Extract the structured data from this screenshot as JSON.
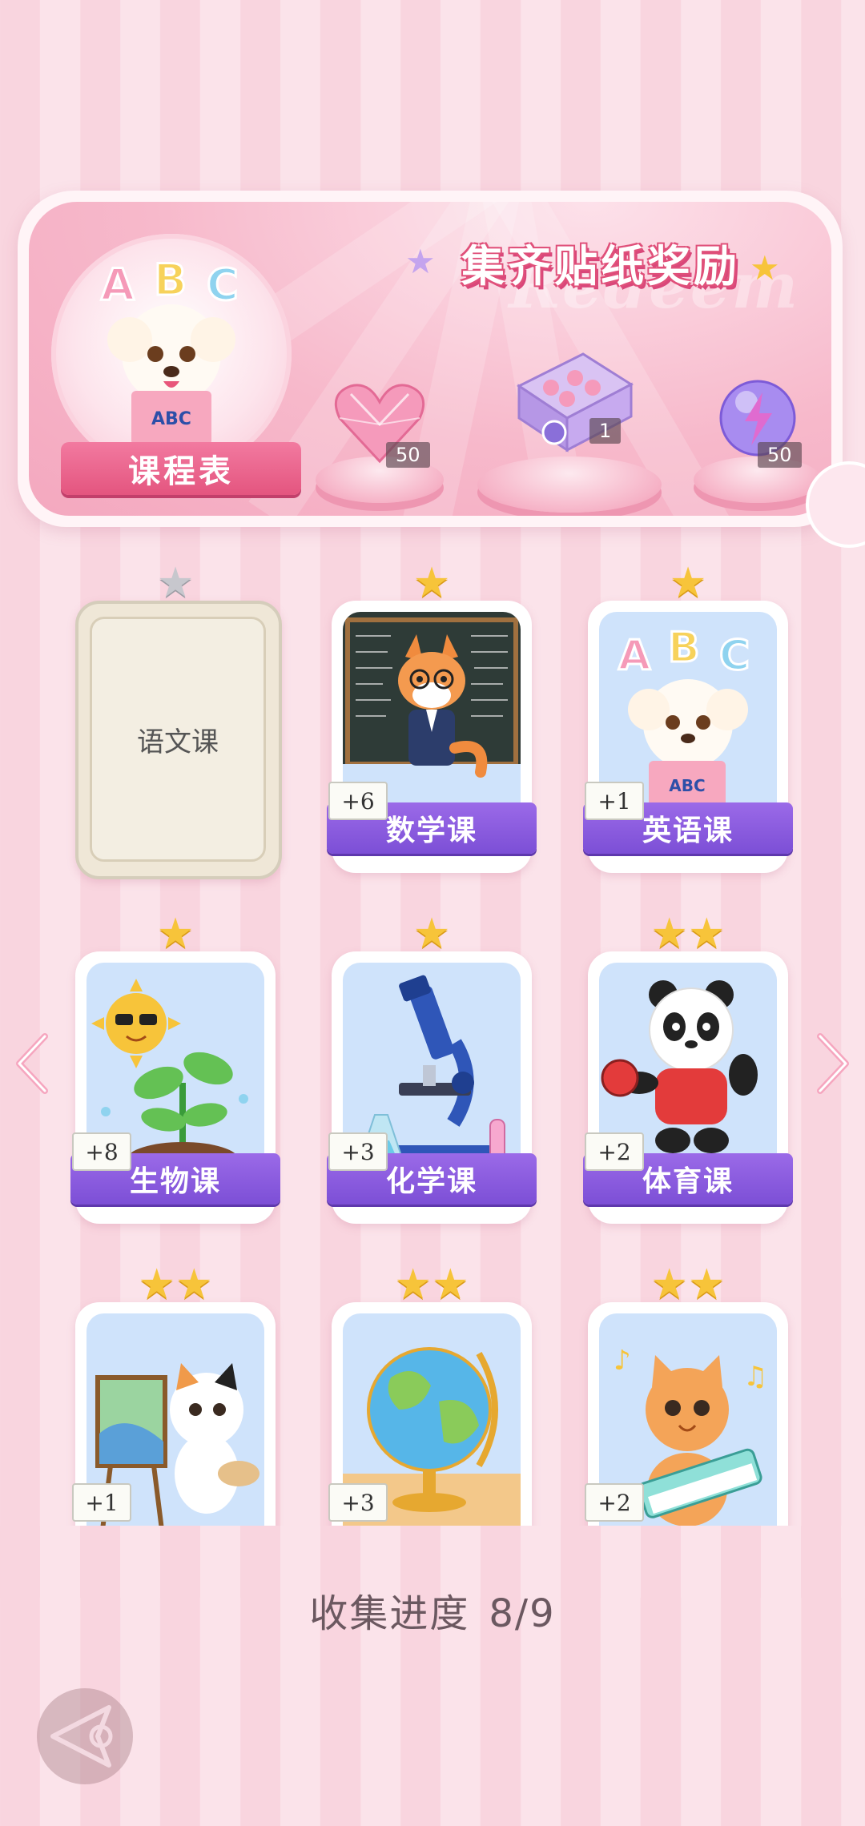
{
  "banner": {
    "title": "集齐贴纸奖励",
    "watermark": "Redeem",
    "schedule_label": "课程表",
    "rewards": [
      {
        "name": "heart-gem",
        "count": "50"
      },
      {
        "name": "sticker-box",
        "count": "1"
      },
      {
        "name": "lightning-orb",
        "count": "50"
      }
    ]
  },
  "cards": [
    {
      "label": "语文课",
      "stars": 1,
      "star_grey": true,
      "locked": true,
      "bonus": ""
    },
    {
      "label": "数学课",
      "stars": 1,
      "bonus": "+6",
      "icon": "fox-teacher"
    },
    {
      "label": "英语课",
      "stars": 1,
      "bonus": "+1",
      "icon": "puppy-abc"
    },
    {
      "label": "生物课",
      "stars": 1,
      "bonus": "+8",
      "icon": "sun-sprout"
    },
    {
      "label": "化学课",
      "stars": 1,
      "bonus": "+3",
      "icon": "microscope"
    },
    {
      "label": "体育课",
      "stars": 2,
      "bonus": "+2",
      "icon": "panda-pingpong"
    },
    {
      "label": "",
      "stars": 2,
      "bonus": "+1",
      "icon": "cat-painter"
    },
    {
      "label": "",
      "stars": 2,
      "bonus": "+3",
      "icon": "globe"
    },
    {
      "label": "",
      "stars": 2,
      "bonus": "+2",
      "icon": "cat-keyboard"
    }
  ],
  "progress": {
    "label": "收集进度",
    "value": "8/9"
  },
  "colors": {
    "accent": "#8a5be0",
    "banner_pink": "#f4a8bf",
    "star": "#f7c43a"
  }
}
